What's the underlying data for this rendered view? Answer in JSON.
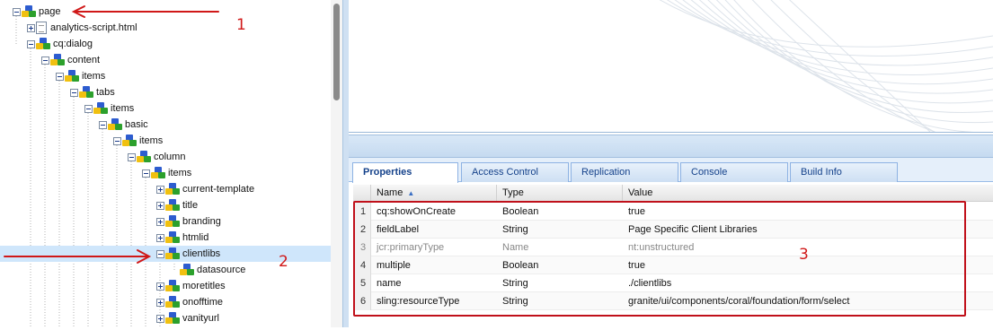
{
  "tree": {
    "nodes": [
      {
        "label": "page",
        "name": "tree-node-page",
        "icon": "node-icon",
        "expander": "minus",
        "selected": false
      },
      {
        "label": "analytics-script.html",
        "name": "tree-node-analytics-script",
        "icon": "file-icon",
        "expander": "plus",
        "selected": false
      },
      {
        "label": "cq:dialog",
        "name": "tree-node-cq-dialog",
        "icon": "node-icon",
        "expander": "minus",
        "selected": false
      },
      {
        "label": "content",
        "name": "tree-node-content",
        "icon": "node-icon",
        "expander": "minus",
        "selected": false
      },
      {
        "label": "items",
        "name": "tree-node-items",
        "icon": "node-icon",
        "expander": "minus",
        "selected": false
      },
      {
        "label": "tabs",
        "name": "tree-node-tabs",
        "icon": "node-icon",
        "expander": "minus",
        "selected": false
      },
      {
        "label": "items",
        "name": "tree-node-items",
        "icon": "node-icon",
        "expander": "minus",
        "selected": false
      },
      {
        "label": "basic",
        "name": "tree-node-basic",
        "icon": "node-icon",
        "expander": "minus",
        "selected": false
      },
      {
        "label": "items",
        "name": "tree-node-items",
        "icon": "node-icon",
        "expander": "minus",
        "selected": false
      },
      {
        "label": "column",
        "name": "tree-node-column",
        "icon": "node-icon",
        "expander": "minus",
        "selected": false
      },
      {
        "label": "items",
        "name": "tree-node-items",
        "icon": "node-icon",
        "expander": "minus",
        "selected": false
      },
      {
        "label": "current-template",
        "name": "tree-node-current-template",
        "icon": "node-icon",
        "expander": "plus",
        "selected": false
      },
      {
        "label": "title",
        "name": "tree-node-title",
        "icon": "node-icon",
        "expander": "plus",
        "selected": false
      },
      {
        "label": "branding",
        "name": "tree-node-branding",
        "icon": "node-icon",
        "expander": "plus",
        "selected": false
      },
      {
        "label": "htmlid",
        "name": "tree-node-htmlid",
        "icon": "node-icon",
        "expander": "plus",
        "selected": false
      },
      {
        "label": "clientlibs",
        "name": "tree-node-clientlibs",
        "icon": "node-icon",
        "expander": "minus",
        "selected": true
      },
      {
        "label": "datasource",
        "name": "tree-node-datasource",
        "icon": "node-icon",
        "expander": "none",
        "selected": false
      },
      {
        "label": "moretitles",
        "name": "tree-node-moretitles",
        "icon": "node-icon",
        "expander": "plus",
        "selected": false
      },
      {
        "label": "onofftime",
        "name": "tree-node-onofftime",
        "icon": "node-icon",
        "expander": "plus",
        "selected": false
      },
      {
        "label": "vanityurl",
        "name": "tree-node-vanityurl",
        "icon": "node-icon",
        "expander": "plus",
        "selected": false
      }
    ]
  },
  "tabs": [
    {
      "label": "Properties",
      "active": true
    },
    {
      "label": "Access Control",
      "active": false
    },
    {
      "label": "Replication",
      "active": false
    },
    {
      "label": "Console",
      "active": false
    },
    {
      "label": "Build Info",
      "active": false
    }
  ],
  "grid": {
    "columns": {
      "name": "Name",
      "type": "Type",
      "value": "Value"
    },
    "sort_indicator": "▲",
    "rows": [
      {
        "num": "1",
        "name": "cq:showOnCreate",
        "type": "Boolean",
        "value": "true",
        "muted": false
      },
      {
        "num": "2",
        "name": "fieldLabel",
        "type": "String",
        "value": "Page Specific Client Libraries",
        "muted": false
      },
      {
        "num": "3",
        "name": "jcr:primaryType",
        "type": "Name",
        "value": "nt:unstructured",
        "muted": true
      },
      {
        "num": "4",
        "name": "multiple",
        "type": "Boolean",
        "value": "true",
        "muted": false
      },
      {
        "num": "5",
        "name": "name",
        "type": "String",
        "value": "./clientlibs",
        "muted": false
      },
      {
        "num": "6",
        "name": "sling:resourceType",
        "type": "String",
        "value": "granite/ui/components/coral/foundation/form/select",
        "muted": false
      }
    ]
  },
  "annotations": {
    "label_1": "1",
    "label_2": "2",
    "label_3": "3",
    "color": "#d01818"
  },
  "colors": {
    "selection": "#cfe6fb",
    "tab_text": "#15428b"
  }
}
